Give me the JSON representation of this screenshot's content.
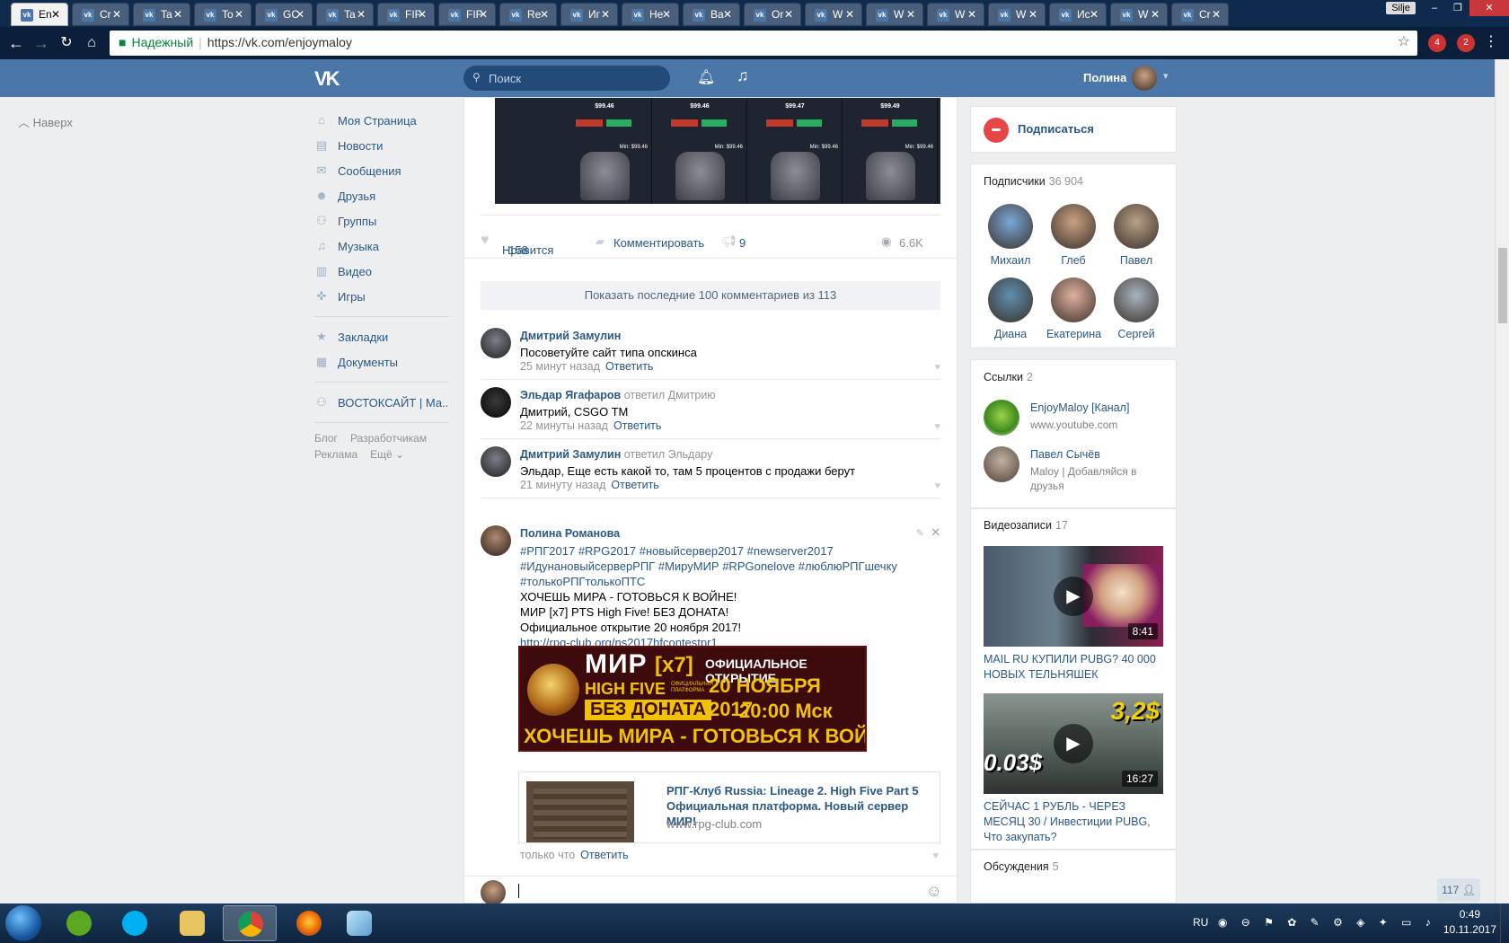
{
  "browser": {
    "tabs": [
      {
        "label": "En"
      },
      {
        "label": "Cr"
      },
      {
        "label": "Ta"
      },
      {
        "label": "To"
      },
      {
        "label": "GC"
      },
      {
        "label": "Ta"
      },
      {
        "label": "FIF"
      },
      {
        "label": "FIF"
      },
      {
        "label": "Re"
      },
      {
        "label": "Иг"
      },
      {
        "label": "He"
      },
      {
        "label": "Ba"
      },
      {
        "label": "Or"
      },
      {
        "label": "W"
      },
      {
        "label": "W"
      },
      {
        "label": "W"
      },
      {
        "label": "W"
      },
      {
        "label": "Ис"
      },
      {
        "label": "W"
      },
      {
        "label": "Cr"
      }
    ],
    "user_chip": "Silje",
    "security_label": "Надежный",
    "url": "https://vk.com/enjoymaloy",
    "ext_badges": [
      "4",
      "2"
    ]
  },
  "vk_header": {
    "search_placeholder": "Поиск",
    "user_name": "Полина"
  },
  "page": {
    "back_to_top": "Наверх"
  },
  "left_menu": {
    "items": [
      {
        "label": "Моя Страница",
        "icon": "home-icon"
      },
      {
        "label": "Новости",
        "icon": "news-icon"
      },
      {
        "label": "Сообщения",
        "icon": "messages-icon"
      },
      {
        "label": "Друзья",
        "icon": "friends-icon"
      },
      {
        "label": "Группы",
        "icon": "groups-icon"
      },
      {
        "label": "Музыка",
        "icon": "music-icon"
      },
      {
        "label": "Видео",
        "icon": "video-icon"
      },
      {
        "label": "Игры",
        "icon": "games-icon"
      }
    ],
    "items2": [
      {
        "label": "Закладки",
        "icon": "star-icon"
      },
      {
        "label": "Документы",
        "icon": "document-icon"
      }
    ],
    "group_item": "ВОСТОКСАЙТ | Ма..",
    "footer": [
      "Блог",
      "Разработчикам",
      "Реклама",
      "Ещё"
    ]
  },
  "post": {
    "game_prices": [
      "$99.46",
      "$99.46",
      "$99.47",
      "$99.49"
    ],
    "game_min_prices": [
      "Min: $99.46",
      "Min: $99.46",
      "Min: $99.46",
      "Min: $99.46"
    ],
    "likes_label": "Нравится",
    "likes_count": "158",
    "comment_label": "Комментировать",
    "shares_count": "9",
    "views": "6.6K"
  },
  "comments": {
    "show_more": "Показать последние 100 комментариев из 113",
    "reply_label": "Ответить",
    "list": [
      {
        "author": "Дмитрий Замулин",
        "replied_to": "",
        "text": "Посоветуйте сайт типа опскинса",
        "time": "25 минут назад"
      },
      {
        "author": "Эльдар Ягафаров",
        "replied_to": "ответил Дмитрию",
        "text": "Дмитрий, CSGO TM",
        "time": "22 минуты назад"
      },
      {
        "author": "Дмитрий Замулин",
        "replied_to": "ответил Эльдару",
        "text": "Эльдар, Еще есть какой то, там 5 процентов с продажи берут",
        "time": "21 минуту назад"
      }
    ],
    "last": {
      "author": "Полина Романова",
      "tags_line1": "#РПГ2017 #RPG2017 #новыйсервер2017 #newserver2017",
      "tags_line2": "#ИдунановыйсерверРПГ #МируМИР #RPGonelove #люблюРПГшечку",
      "tags_line3": "#толькоРПГтолькоПТС",
      "line1": "ХОЧЕШЬ МИРА - ГОТОВЬСЯ К ВОЙНЕ!",
      "line2": "МИР [x7] PTS High Five! БЕЗ ДОНАТА!",
      "line3": "Официальное открытие 20 ноября 2017!",
      "link": "http://rpg-club.org/ns2017hfcontestpr1",
      "time": "только что"
    },
    "banner": {
      "title": "МИР",
      "rate": "[x7]",
      "sub": "HIGH FIVE",
      "platform": "ОФИЦИАЛЬНАЯ ПЛАТФОРМА",
      "nodonate": "БЕЗ ДОНАТА",
      "opening": "ОФИЦИАЛЬНОЕ ОТКРЫТИЕ",
      "date": "20 НОЯБРЯ 2017",
      "time": "20:00 Мск",
      "slogan": "ХОЧЕШЬ МИРА - ГОТОВЬСЯ К ВОЙНЕ"
    },
    "snippet": {
      "title": "РПГ-Клуб Russia: Lineage 2. High Five Part 5 Официальная платформа. Новый сервер МИР!",
      "url": "www.rpg-club.com"
    }
  },
  "right": {
    "subscribe": "Подписаться",
    "subscribers_label": "Подписчики",
    "subscribers_count": "36 904",
    "subscribers": [
      {
        "name": "Михаил"
      },
      {
        "name": "Глеб"
      },
      {
        "name": "Павел"
      },
      {
        "name": "Диана"
      },
      {
        "name": "Екатерина"
      },
      {
        "name": "Сергей"
      }
    ],
    "links_label": "Ссылки",
    "links_count": "2",
    "links": [
      {
        "title": "EnjoyMaloy [Канал]",
        "desc": "www.youtube.com"
      },
      {
        "title": "Павел Сычёв",
        "desc": "Maloy | Добавляйся в друзья"
      }
    ],
    "videos_label": "Видеозаписи",
    "videos_count": "17",
    "videos": [
      {
        "duration": "8:41",
        "title": "MAIL RU КУПИЛИ PUBG? 40 000 НОВЫХ ТЕЛЬНЯШЕК"
      },
      {
        "duration": "16:27",
        "title": "СЕЙЧАС 1 РУБЛЬ - ЧЕРЕЗ МЕСЯЦ 30 / Инвестиции PUBG, Что закупать?",
        "overlay_left": "0.03$",
        "overlay_right": "3,2$"
      }
    ],
    "discussions_label": "Обсуждения",
    "discussions_count": "5"
  },
  "online_count": "117",
  "taskbar": {
    "lang": "RU",
    "time": "0:49",
    "date": "10.11.2017"
  }
}
